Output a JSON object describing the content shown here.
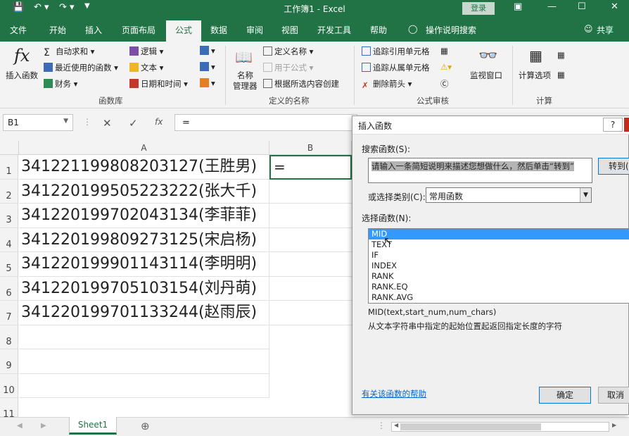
{
  "window": {
    "title": "工作簿1 - Excel",
    "login": "登录"
  },
  "tabs": [
    "文件",
    "开始",
    "插入",
    "页面布局",
    "公式",
    "数据",
    "审阅",
    "视图",
    "开发工具",
    "帮助"
  ],
  "tell_me": "操作说明搜索",
  "share": "共享",
  "ribbon": {
    "insert_function": "插入函数",
    "autosum": "自动求和",
    "recent": "最近使用的函数",
    "financial": "财务",
    "logical": "逻辑",
    "text": "文本",
    "datetime": "日期和时间",
    "group_library": "函数库",
    "name_manager_1": "名称",
    "name_manager_2": "管理器",
    "define_name": "定义名称",
    "use_in_formula": "用于公式",
    "create_from_sel": "根据所选内容创建",
    "group_names": "定义的名称",
    "trace_precedents": "追踪引用单元格",
    "trace_dependents": "追踪从属单元格",
    "remove_arrows": "删除箭头",
    "watch_window": "监视窗口",
    "group_audit": "公式审核",
    "calc_options": "计算选项",
    "group_calc": "计算"
  },
  "formula_bar": {
    "name_box": "B1",
    "formula": "="
  },
  "sheet": {
    "col_a": "A",
    "col_b": "B",
    "rows": [
      "1",
      "2",
      "3",
      "4",
      "5",
      "6",
      "7",
      "8",
      "9",
      "10",
      "11"
    ],
    "cells": [
      "341221199808203127(王胜男)",
      "341220199505223222(张大千)",
      "341220199702043134(李菲菲)",
      "341220199809273125(宋启杨)",
      "341220199901143114(李明明)",
      "341220199705103154(刘丹萌)",
      "341220199701133244(赵雨辰)"
    ],
    "b1": "=",
    "tab": "Sheet1"
  },
  "dialog": {
    "title": "插入函数",
    "search_label": "搜索函数(S):",
    "search_text": "请输入一条简短说明来描述您想做什么，然后单击“转到”",
    "go": "转到(",
    "category_label": "或选择类别(C):",
    "category": "常用函数",
    "select_label": "选择函数(N):",
    "functions": [
      "MID",
      "TEXT",
      "IF",
      "INDEX",
      "RANK",
      "RANK.EQ",
      "RANK.AVG"
    ],
    "selected": "MID",
    "syntax": "MID(text,start_num,num_chars)",
    "description": "从文本字符串中指定的起始位置起返回指定长度的字符",
    "help_link": "有关该函数的帮助",
    "ok": "确定",
    "cancel": "取消"
  },
  "colors": {
    "brand": "#217346",
    "selection": "#3399ff"
  }
}
